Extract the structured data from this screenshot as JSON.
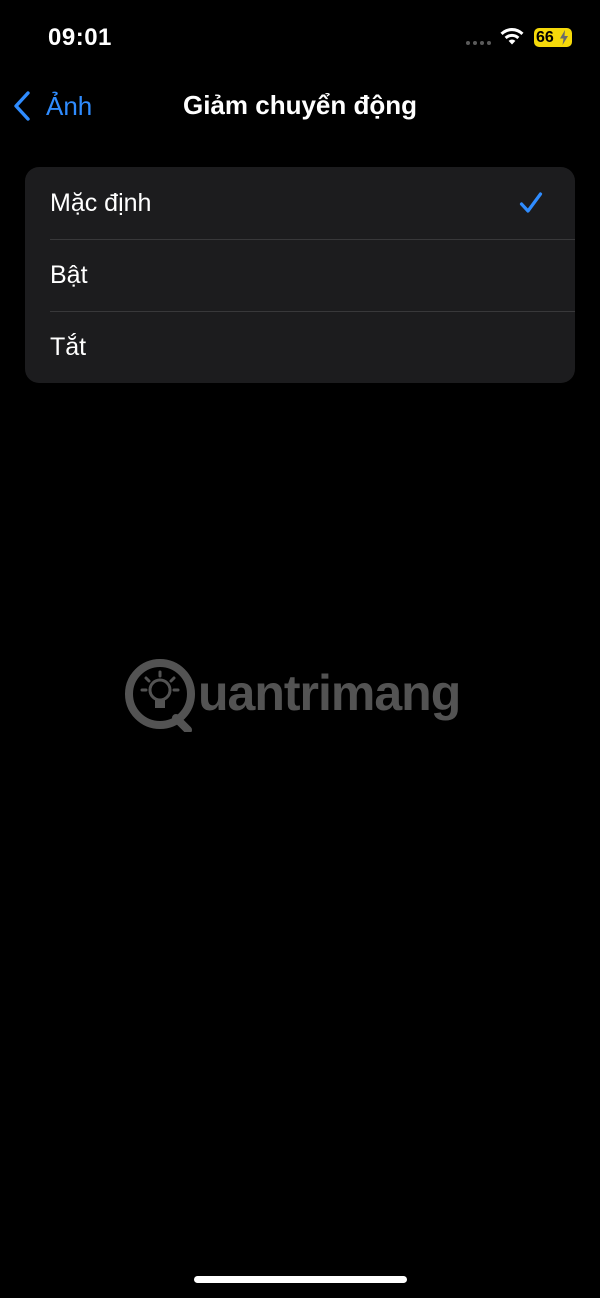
{
  "status_bar": {
    "time": "09:01",
    "battery_level": "66",
    "battery_color": "#f5d90a",
    "icons": [
      "signal-dots-icon",
      "wifi-icon",
      "battery-charging-icon"
    ]
  },
  "nav": {
    "back_label": "Ảnh",
    "title": "Giảm chuyển động",
    "accent_color": "#2f8cff"
  },
  "options": [
    {
      "label": "Mặc định",
      "selected": true
    },
    {
      "label": "Bật",
      "selected": false
    },
    {
      "label": "Tắt",
      "selected": false
    }
  ],
  "watermark": {
    "text": "uantrimang"
  }
}
